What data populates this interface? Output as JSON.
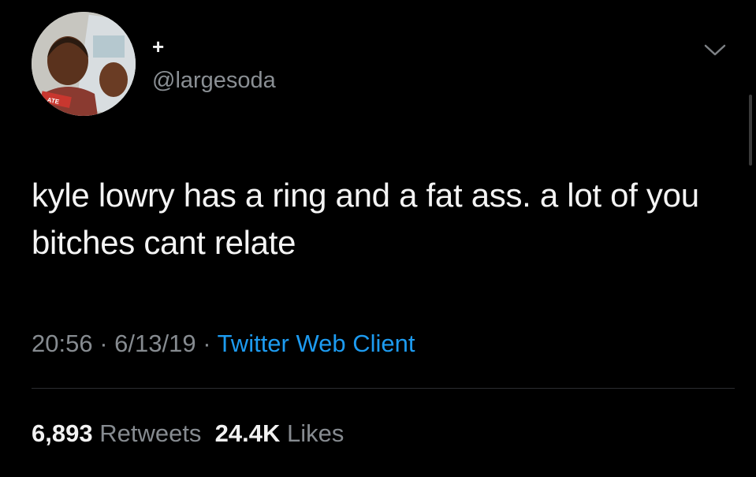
{
  "user": {
    "display_name": "+",
    "handle": "@largesoda",
    "avatar_icon": "profile-photo",
    "avatar_badge_text": "ATE"
  },
  "menu": {
    "caret_icon": "chevron-down-icon"
  },
  "tweet": {
    "text": "kyle lowry has a ring and a fat ass. a lot of you bitches cant relate",
    "time": "20:56",
    "separator_1": " · ",
    "date": "6/13/19",
    "separator_2": " · ",
    "client": "Twitter Web Client"
  },
  "stats": {
    "retweets_count": "6,893",
    "retweets_label": "Retweets",
    "likes_count": "24.4K",
    "likes_label": "Likes"
  },
  "colors": {
    "background": "#000000",
    "primary_text": "#f4f4f4",
    "secondary_text": "#868b90",
    "link": "#1d9bf0",
    "divider": "#2b2d30"
  }
}
